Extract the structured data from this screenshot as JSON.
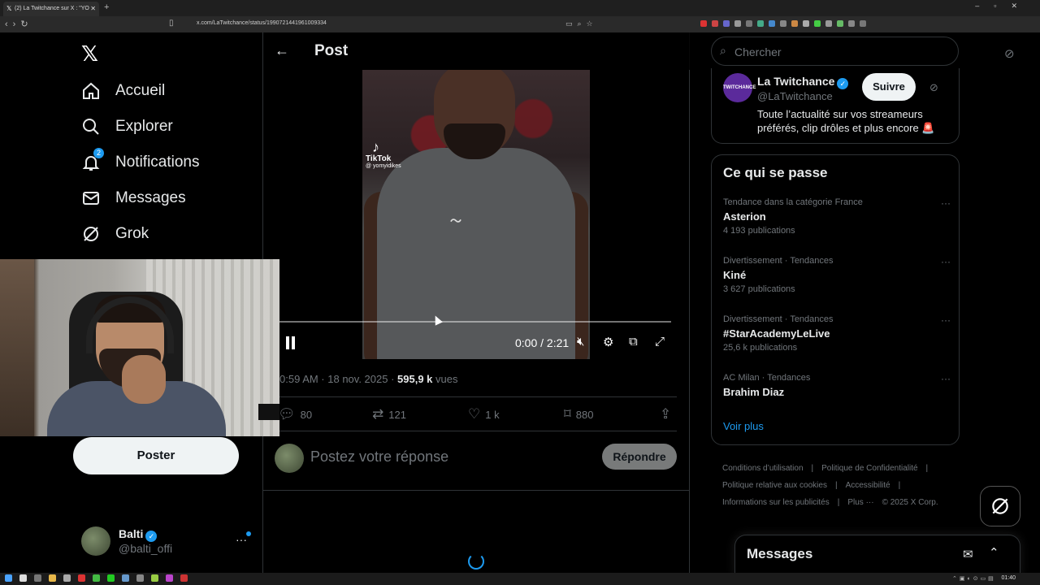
{
  "browser": {
    "tab_title": "(2) La Twitchance sur X : \"YO",
    "url": "x.com/LaTwitchance/status/1990721441961009334"
  },
  "nav": {
    "items": [
      {
        "label": "Accueil",
        "icon": "home-icon"
      },
      {
        "label": "Explorer",
        "icon": "search-icon"
      },
      {
        "label": "Notifications",
        "icon": "bell-icon",
        "badge": "2"
      },
      {
        "label": "Messages",
        "icon": "mail-icon"
      },
      {
        "label": "Grok",
        "icon": "grok-icon"
      }
    ],
    "post_button": "Poster",
    "account": {
      "name": "Balti",
      "handle": "@balti_offi"
    }
  },
  "post": {
    "header_title": "Post",
    "video": {
      "watermark_brand": "TikTok",
      "watermark_user": "@ yomyidikes",
      "time": "0:00 / 2:21",
      "progress_fraction": 0.0
    },
    "timestamp": "0:59 AM · 18 nov. 2025 · ",
    "views_count": "595,9 k",
    "views_label": " vues",
    "stats": {
      "replies": "80",
      "reposts": "121",
      "likes": "1 k",
      "bookmarks": "880"
    },
    "reply_placeholder": "Postez votre réponse",
    "reply_button": "Répondre"
  },
  "search": {
    "placeholder": "Chercher"
  },
  "profile_card": {
    "avatar_text": "TWITCHANCE",
    "name": "La Twitchance",
    "handle": "@LaTwitchance",
    "follow_label": "Suivre",
    "bio": "Toute l’actualité sur vos streameurs préférés, clip drôles et plus encore 🚨"
  },
  "trends": {
    "title": "Ce qui se passe",
    "items": [
      {
        "context": "Tendance dans la catégorie France",
        "title": "Asterion",
        "count": "4 193 publications"
      },
      {
        "context": "Divertissement · Tendances",
        "title": "Kiné",
        "count": "3 627 publications"
      },
      {
        "context": "Divertissement · Tendances",
        "title": "#StarAcademyLeLive",
        "count": "25,6 k publications"
      },
      {
        "context": "AC Milan · Tendances",
        "title": "Brahim Diaz",
        "count": ""
      }
    ],
    "more": "Voir plus"
  },
  "footer": {
    "links": [
      "Conditions d’utilisation",
      "|",
      "Politique de Confidentialité",
      "|",
      "Politique relative aux cookies",
      "|",
      "Accessibilité",
      "|",
      "Informations sur les publicités",
      "|",
      "Plus ···",
      "© 2025 X Corp."
    ]
  },
  "messages_drawer": {
    "title": "Messages"
  },
  "taskbar": {
    "clock": "01:40"
  }
}
